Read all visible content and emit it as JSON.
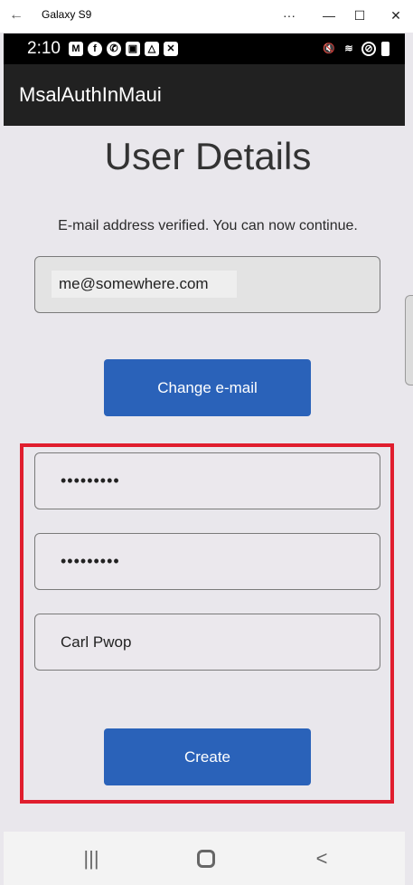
{
  "window": {
    "title": "Galaxy S9",
    "back_glyph": "←",
    "more_glyph": "···",
    "min_glyph": "—",
    "max_glyph": "☐",
    "close_glyph": "✕"
  },
  "status_bar": {
    "time": "2:10",
    "left_icons": [
      "gmail-icon",
      "facebook-icon",
      "whatsapp-icon",
      "app-icon",
      "drive-icon",
      "x-icon"
    ],
    "right_icons": [
      "mute-icon",
      "wifi-icon",
      "blocked-icon",
      "battery-icon"
    ]
  },
  "app_bar": {
    "title": "MsalAuthInMaui"
  },
  "page": {
    "title": "User Details",
    "verified_message": "E-mail address verified. You can now continue.",
    "email_value": "me@somewhere.com",
    "change_email_label": "Change e-mail",
    "password_value": "•••••••••",
    "confirm_password_value": "•••••••••",
    "display_name_value": "Carl Pwop",
    "create_label": "Create"
  },
  "colors": {
    "button_blue": "#2a62b9",
    "highlight_red": "#e01e2e",
    "app_bar": "#212121",
    "page_bg": "#e9e7ec"
  },
  "nav_bar": {
    "recent_glyph": "|||",
    "back_glyph": "<"
  }
}
